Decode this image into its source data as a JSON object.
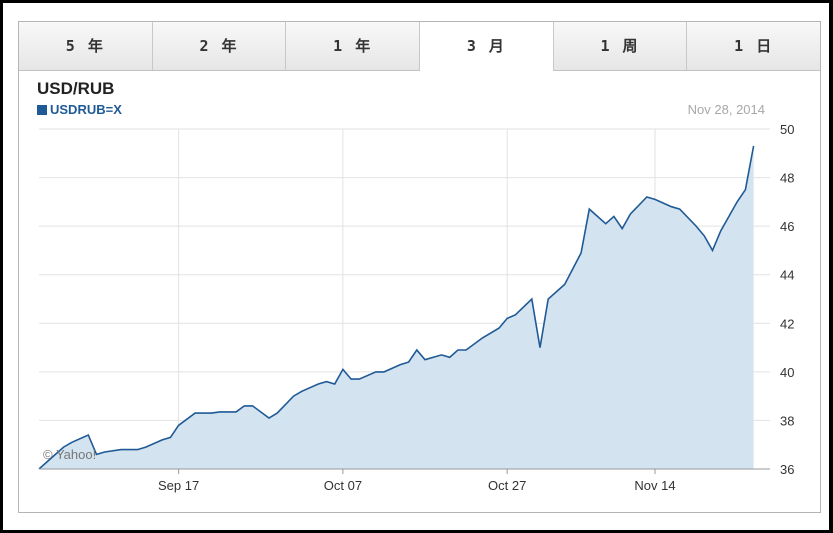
{
  "tabs": [
    {
      "label": "5 年",
      "active": false
    },
    {
      "label": "2 年",
      "active": false
    },
    {
      "label": "1 年",
      "active": false
    },
    {
      "label": "3 月",
      "active": true
    },
    {
      "label": "1 周",
      "active": false
    },
    {
      "label": "1 日",
      "active": false
    }
  ],
  "header": {
    "title": "USD/RUB",
    "legend_label": "USDRUB=X",
    "date": "Nov 28, 2014",
    "watermark": "© Yahoo!"
  },
  "colors": {
    "line": "#1f5a96",
    "fill": "#d4e3f0",
    "grid": "#e2e2e2"
  },
  "chart_data": {
    "type": "area",
    "title": "USD/RUB",
    "series": [
      {
        "name": "USDRUB=X"
      }
    ],
    "ylim": [
      36,
      50
    ],
    "y_ticks": [
      36,
      38,
      40,
      42,
      44,
      46,
      48,
      50
    ],
    "x_ticks": [
      {
        "label": "Sep 17",
        "t": 17
      },
      {
        "label": "Oct 07",
        "t": 37
      },
      {
        "label": "Oct 27",
        "t": 57
      },
      {
        "label": "Nov 14",
        "t": 75
      }
    ],
    "xlim": [
      0,
      89
    ],
    "points": [
      [
        0,
        36.0
      ],
      [
        2,
        36.6
      ],
      [
        3,
        36.9
      ],
      [
        4,
        37.1
      ],
      [
        6,
        37.4
      ],
      [
        7,
        36.6
      ],
      [
        8,
        36.7
      ],
      [
        10,
        36.8
      ],
      [
        12,
        36.8
      ],
      [
        13,
        36.9
      ],
      [
        15,
        37.2
      ],
      [
        16,
        37.3
      ],
      [
        17,
        37.8
      ],
      [
        19,
        38.3
      ],
      [
        21,
        38.3
      ],
      [
        22,
        38.35
      ],
      [
        24,
        38.35
      ],
      [
        25,
        38.6
      ],
      [
        26,
        38.6
      ],
      [
        28,
        38.1
      ],
      [
        29,
        38.3
      ],
      [
        31,
        39.0
      ],
      [
        32,
        39.2
      ],
      [
        34,
        39.5
      ],
      [
        35,
        39.6
      ],
      [
        36,
        39.5
      ],
      [
        37,
        40.1
      ],
      [
        38,
        39.7
      ],
      [
        39,
        39.7
      ],
      [
        41,
        40.0
      ],
      [
        42,
        40.0
      ],
      [
        44,
        40.3
      ],
      [
        45,
        40.4
      ],
      [
        46,
        40.9
      ],
      [
        47,
        40.5
      ],
      [
        49,
        40.7
      ],
      [
        50,
        40.6
      ],
      [
        51,
        40.9
      ],
      [
        52,
        40.9
      ],
      [
        54,
        41.4
      ],
      [
        56,
        41.8
      ],
      [
        57,
        42.2
      ],
      [
        58,
        42.35
      ],
      [
        60,
        43.0
      ],
      [
        61,
        41.0
      ],
      [
        62,
        43.0
      ],
      [
        64,
        43.6
      ],
      [
        66,
        44.9
      ],
      [
        67,
        46.7
      ],
      [
        69,
        46.1
      ],
      [
        70,
        46.4
      ],
      [
        71,
        45.9
      ],
      [
        72,
        46.5
      ],
      [
        74,
        47.2
      ],
      [
        75,
        47.1
      ],
      [
        77,
        46.8
      ],
      [
        78,
        46.7
      ],
      [
        80,
        46.0
      ],
      [
        81,
        45.6
      ],
      [
        82,
        45.0
      ],
      [
        83,
        45.8
      ],
      [
        85,
        47.0
      ],
      [
        86,
        47.5
      ],
      [
        87,
        49.3
      ]
    ]
  }
}
